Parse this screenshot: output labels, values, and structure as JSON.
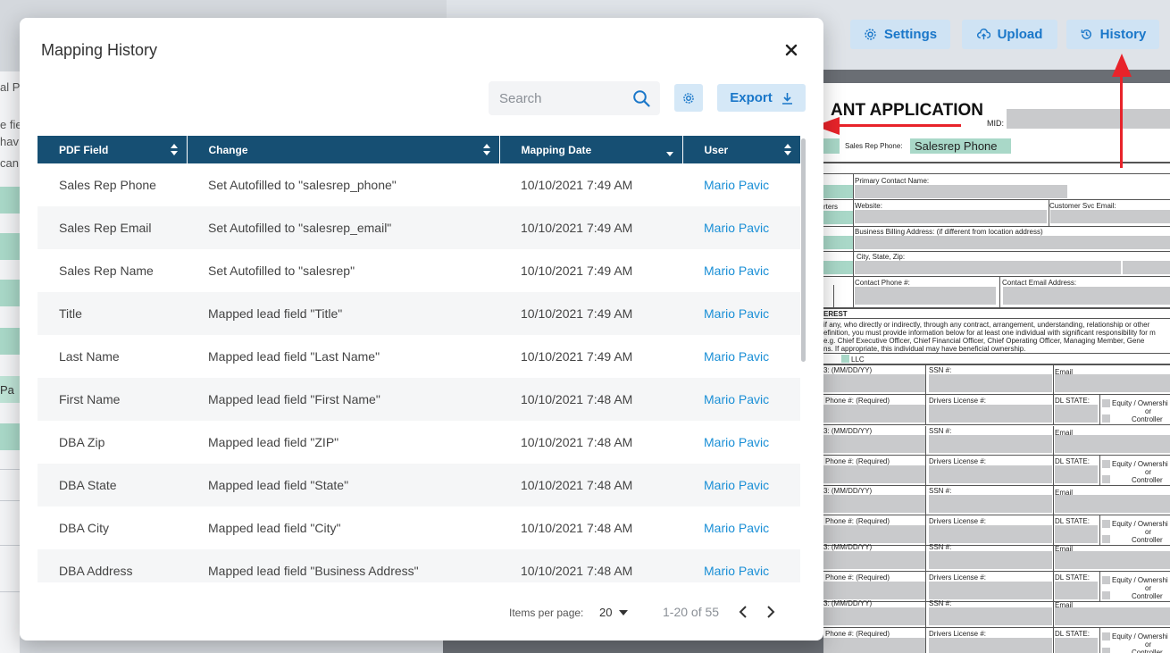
{
  "background": {
    "left_fragments": [
      "al Pr",
      "e fie",
      "hav",
      "can",
      "Pa"
    ],
    "toolbar": {
      "settings_label": "Settings",
      "upload_label": "Upload",
      "history_label": "History"
    },
    "document": {
      "title": "ANT APPLICATION",
      "mid_label": "MID:",
      "sales_rep_phone_label": "Sales Rep Phone:",
      "sales_rep_phone_value": "Salesrep Phone",
      "labels": {
        "primary_contact": "Primary Contact Name:",
        "website": "Website:",
        "customer_svc_email": "Customer Svc Email:",
        "billing_address": "Business Billing Address: (if different from location address)",
        "city_state_zip": "City, State, Zip:",
        "contact_phone": "Contact Phone #:",
        "contact_email": "Contact Email Address:",
        "interest": "EREST",
        "para1": "if any, who directly or indirectly, through any contract, arrangement, understanding, relationship or other",
        "para2": "efinition, you must provide information below for at least one individual with significant responsibility for m",
        "para3": "e.g. Chief Executive Officer, Chief Financial Officer, Chief Operating Officer, Managing Member, Gene",
        "para4": "ns. If appropriate, this individual may have beneficial ownership.",
        "llc": "LLC",
        "dob": "3: (MM/DD/YY)",
        "ssn": "SSN #:",
        "email": "Email",
        "phone_required": "Phone #: (Required)",
        "drivers_license": "Drivers License #:",
        "dl_state": "DL STATE:",
        "equity": "Equity / Ownershi",
        "or": "or",
        "controller": "Controller",
        "sales_rep_short": "rters"
      }
    }
  },
  "modal": {
    "title": "Mapping History",
    "search": {
      "placeholder": "Search",
      "value": ""
    },
    "export_label": "Export",
    "columns": [
      "PDF Field",
      "Change",
      "Mapping Date",
      "User"
    ],
    "rows": [
      {
        "field": "Sales Rep Phone",
        "change": "Set Autofilled to \"salesrep_phone\"",
        "date": "10/10/2021 7:49 AM",
        "user": "Mario Pavic"
      },
      {
        "field": "Sales Rep Email",
        "change": "Set Autofilled to \"salesrep_email\"",
        "date": "10/10/2021 7:49 AM",
        "user": "Mario Pavic"
      },
      {
        "field": "Sales Rep Name",
        "change": "Set Autofilled to \"salesrep\"",
        "date": "10/10/2021 7:49 AM",
        "user": "Mario Pavic"
      },
      {
        "field": "Title",
        "change": "Mapped lead field \"Title\"",
        "date": "10/10/2021 7:49 AM",
        "user": "Mario Pavic"
      },
      {
        "field": "Last Name",
        "change": "Mapped lead field \"Last Name\"",
        "date": "10/10/2021 7:49 AM",
        "user": "Mario Pavic"
      },
      {
        "field": "First Name",
        "change": "Mapped lead field \"First Name\"",
        "date": "10/10/2021 7:48 AM",
        "user": "Mario Pavic"
      },
      {
        "field": "DBA Zip",
        "change": "Mapped lead field \"ZIP\"",
        "date": "10/10/2021 7:48 AM",
        "user": "Mario Pavic"
      },
      {
        "field": "DBA State",
        "change": "Mapped lead field \"State\"",
        "date": "10/10/2021 7:48 AM",
        "user": "Mario Pavic"
      },
      {
        "field": "DBA City",
        "change": "Mapped lead field \"City\"",
        "date": "10/10/2021 7:48 AM",
        "user": "Mario Pavic"
      },
      {
        "field": "DBA Address",
        "change": "Mapped lead field \"Business Address\"",
        "date": "10/10/2021 7:48 AM",
        "user": "Mario Pavic"
      }
    ],
    "paginator": {
      "items_per_page_label": "Items per page:",
      "page_size": "20",
      "range_label": "1-20 of 55"
    }
  },
  "colors": {
    "header_bg": "#164f73",
    "accent": "#1a77c9",
    "link": "#1a8fd6",
    "annotation_arrow": "#e8232a"
  }
}
